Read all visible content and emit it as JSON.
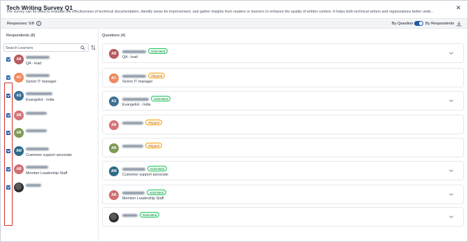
{
  "header": {
    "title": "Tech Writing Survey Q1",
    "description": "The survey can be used to evaluate the effectiveness of technical documentation, identify areas for improvement, and gather insights from readers or learners to enhance the quality of written content. It helps both technical writers and organizations better unde...",
    "close_glyph": "✕"
  },
  "responses_bar": {
    "label": "Responses: 5/8",
    "info_glyph": "i",
    "by_question_label": "By Question",
    "by_respondents_label": "By Respondents",
    "view_toggle_on": true,
    "icons": [
      "info-icon",
      "download-icon"
    ]
  },
  "left_panel": {
    "heading": "Respondents (8)",
    "search_placeholder": "Search Learners",
    "icons": [
      "search-icon",
      "sort-icon",
      "checkbox-checked-icon"
    ],
    "highlight_color": "#d0312d"
  },
  "right_panel": {
    "heading": "Questions (4)",
    "icons": [
      "chevron-down-icon"
    ]
  },
  "respondents": [
    {
      "initials": "AB",
      "subtitle": "QA - lead",
      "status": "Submitted",
      "color": "#b85a5f",
      "has_chevron": true,
      "photo": false,
      "checked": true
    },
    {
      "initials": "AC",
      "subtitle": "Senior IT manager",
      "status": "Skipped",
      "color": "#ee8a60",
      "has_chevron": false,
      "photo": false,
      "checked": true
    },
    {
      "initials": "AS",
      "subtitle": "Evangelist - India",
      "status": "Submitted",
      "color": "#3d6f96",
      "has_chevron": true,
      "photo": false,
      "checked": true
    },
    {
      "initials": "AB",
      "subtitle": "",
      "status": "Skipped",
      "color": "#d57377",
      "has_chevron": false,
      "photo": false,
      "checked": true
    },
    {
      "initials": "AB",
      "subtitle": "",
      "status": "Skipped",
      "color": "#7f9a54",
      "has_chevron": false,
      "photo": false,
      "checked": true
    },
    {
      "initials": "AW",
      "subtitle": "Customer support associate",
      "status": "Submitted",
      "color": "#2f6a88",
      "has_chevron": true,
      "photo": false,
      "checked": true
    },
    {
      "initials": "AB",
      "subtitle": "Member Leadership Staff",
      "status": "Submitted",
      "color": "#cf6e70",
      "has_chevron": true,
      "photo": false,
      "checked": true
    },
    {
      "initials": "",
      "subtitle": "",
      "status": "Submitted",
      "color": "#2b2b2b",
      "has_chevron": true,
      "photo": true,
      "checked": true
    }
  ],
  "colors": {
    "accent": "#1e5aa8",
    "submitted_text": "#15803d",
    "submitted_border": "#22c55e",
    "skipped_text": "#b45309",
    "skipped_border": "#f59e0b"
  }
}
